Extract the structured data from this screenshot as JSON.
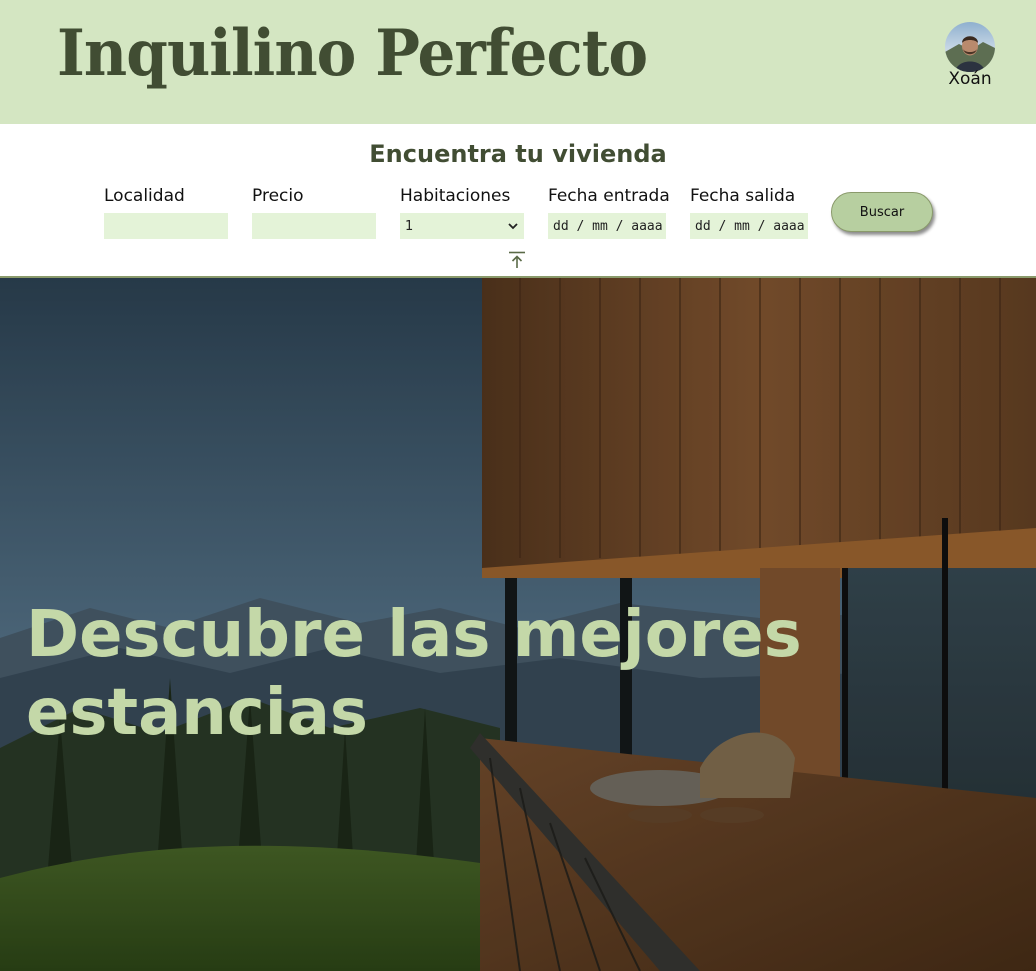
{
  "header": {
    "brand": "Inquilino Perfecto",
    "user_name": "Xoán"
  },
  "search": {
    "title": "Encuentra tu vivienda",
    "fields": {
      "locality_label": "Localidad",
      "locality_value": "",
      "price_label": "Precio",
      "price_value": "",
      "rooms_label": "Habitaciones",
      "rooms_value": "1",
      "checkin_label": "Fecha entrada",
      "checkin_placeholder": "dd / mm / aaaa",
      "checkout_label": "Fecha salida",
      "checkout_placeholder": "dd / mm / aaaa"
    },
    "submit_label": "Buscar"
  },
  "hero": {
    "headline": "Descubre las mejores estancias"
  },
  "colors": {
    "header_bg": "#d4e6c2",
    "brand_text": "#414d33",
    "input_bg": "#e4f3d8",
    "button_bg": "#b7cfa0",
    "hero_text": "#c4d8a8"
  }
}
